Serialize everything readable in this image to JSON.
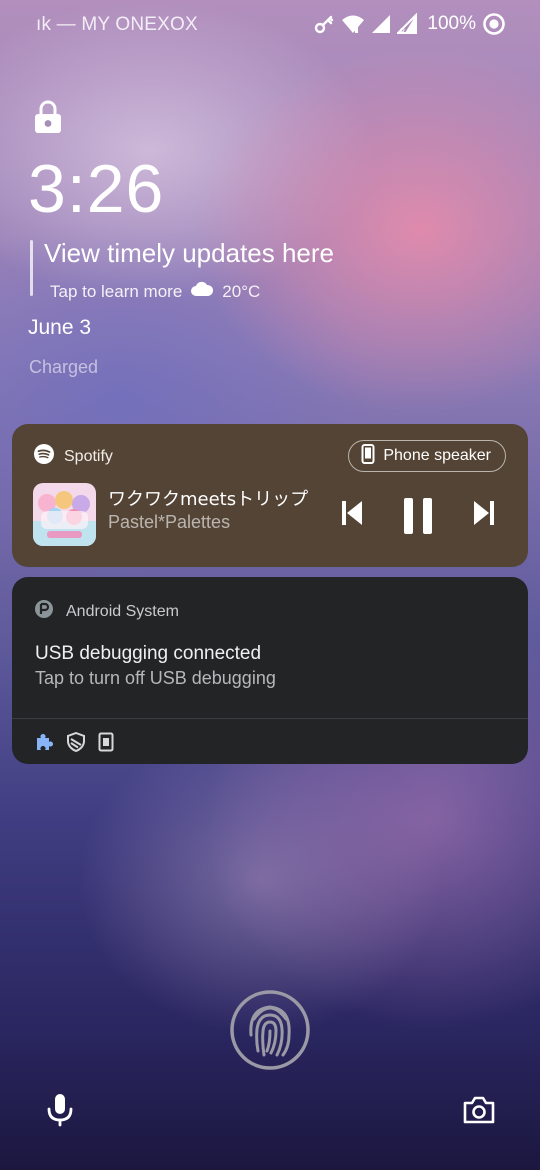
{
  "status_bar": {
    "carrier": "ık — MY ONEXOX",
    "battery": "100%",
    "icons": [
      "key-icon",
      "wifi-icon",
      "signal-icon",
      "signal-roaming-icon",
      "sync-icon"
    ]
  },
  "lockscreen": {
    "time": "3:26",
    "updates_title": "View timely updates here",
    "updates_sub": "Tap to learn more",
    "weather": "20°C",
    "date": "June 3",
    "charge_status": "Charged"
  },
  "spotify": {
    "app": "Spotify",
    "output": "Phone speaker",
    "track": "ワクワクmeetsトリップ",
    "artist": "Pastel*Palettes",
    "colors": {
      "card": "#544435"
    }
  },
  "android_system": {
    "app": "Android System",
    "title": "USB debugging connected",
    "text": "Tap to turn off USB debugging",
    "action_icons": [
      "puzzle-icon",
      "shield-icon",
      "sim-card-icon"
    ]
  },
  "bottom": {
    "icons": [
      "fingerprint-icon",
      "microphone-icon",
      "camera-icon"
    ]
  }
}
